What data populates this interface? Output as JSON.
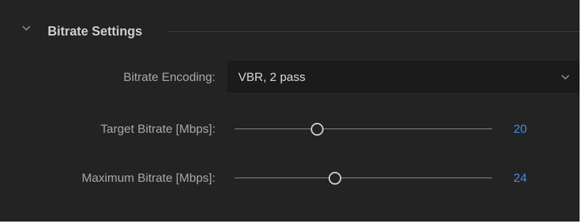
{
  "section": {
    "title": "Bitrate Settings",
    "icon": "chevron-down-icon"
  },
  "bitrate_encoding": {
    "label": "Bitrate Encoding:",
    "value": "VBR, 2 pass",
    "icon": "chevron-down-icon"
  },
  "target_bitrate": {
    "label": "Target Bitrate [Mbps]:",
    "value": "20",
    "position": 0.32
  },
  "maximum_bitrate": {
    "label": "Maximum Bitrate [Mbps]:",
    "value": "24",
    "position": 0.39
  },
  "colors": {
    "background": "#232323",
    "label_text": "#a9a9a9",
    "value_accent": "#3d8fe0",
    "dropdown_bg": "#1b1b1b"
  }
}
